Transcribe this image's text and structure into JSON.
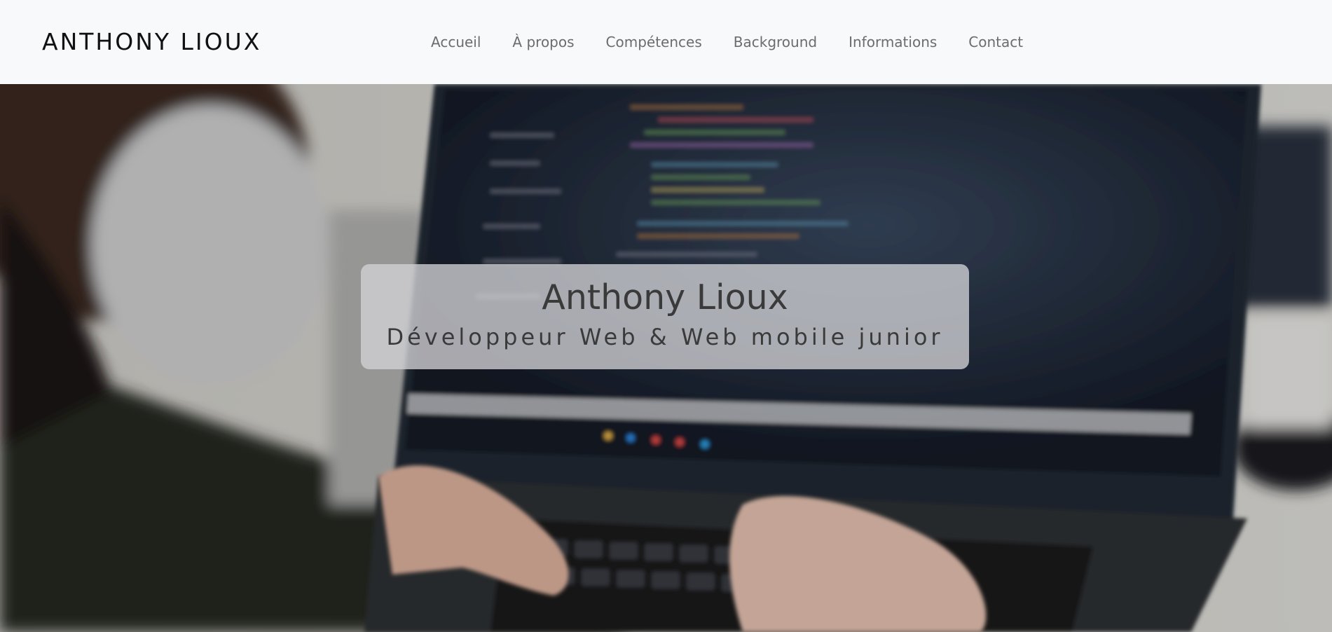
{
  "navbar": {
    "brand": "ANTHONY LIOUX",
    "links": [
      {
        "label": "Accueil"
      },
      {
        "label": "À propos"
      },
      {
        "label": "Compétences"
      },
      {
        "label": "Background"
      },
      {
        "label": "Informations"
      },
      {
        "label": "Contact"
      }
    ]
  },
  "hero": {
    "title": "Anthony Lioux",
    "subtitle": "Développeur Web & Web mobile junior"
  },
  "colors": {
    "navbar_bg": "#f8f9fa",
    "brand_text": "#111111",
    "nav_link": "#6c6c6c",
    "caption_text": "#3a3a3a"
  }
}
